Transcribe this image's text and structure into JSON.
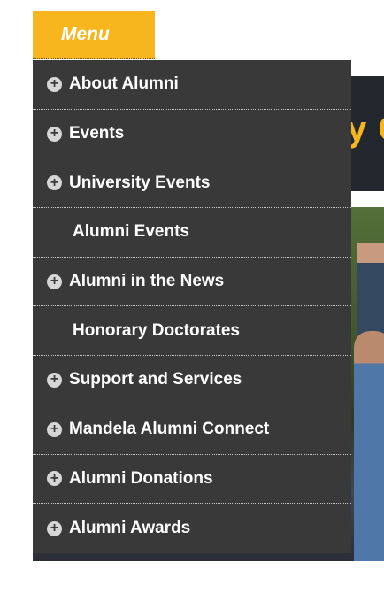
{
  "menu": {
    "toggle_label": "Menu"
  },
  "banner": {
    "text": "y C"
  },
  "nav": {
    "items": [
      {
        "label": "About Alumni",
        "expandable": true
      },
      {
        "label": "Events",
        "expandable": true
      },
      {
        "label": "University Events",
        "expandable": true
      },
      {
        "label": "Alumni Events",
        "expandable": false
      },
      {
        "label": "Alumni in the News",
        "expandable": true
      },
      {
        "label": "Honorary Doctorates",
        "expandable": false
      },
      {
        "label": "Support and Services",
        "expandable": true
      },
      {
        "label": "Mandela Alumni Connect",
        "expandable": true
      },
      {
        "label": "Alumni Donations",
        "expandable": true
      },
      {
        "label": "Alumni Awards",
        "expandable": true
      }
    ]
  },
  "colors": {
    "accent": "#f7b51e",
    "menu_bg": "#3a3939",
    "banner_bg": "#23272e"
  }
}
